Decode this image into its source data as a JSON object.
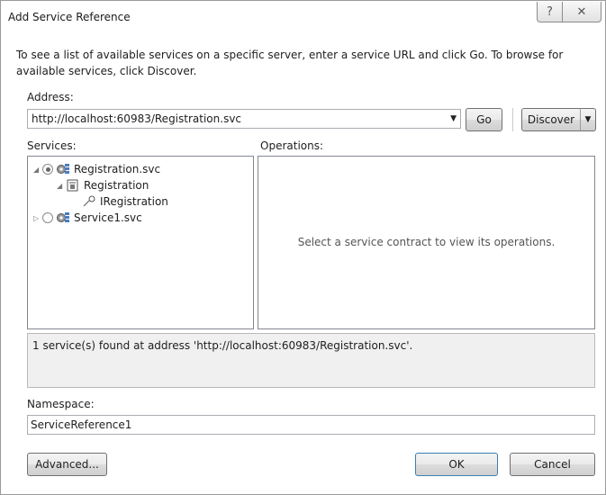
{
  "window": {
    "title": "Add Service Reference",
    "help_icon": "?",
    "close_icon": "✕"
  },
  "instructions": "To see a list of available services on a specific server, enter a service URL and click Go. To browse for available services, click Discover.",
  "address": {
    "label": "Address:",
    "value": "http://localhost:60983/Registration.svc",
    "go_label": "Go",
    "discover_label": "Discover"
  },
  "services": {
    "label": "Services:",
    "tree": [
      {
        "label": "Registration.svc",
        "expanded": true,
        "selected_radio": true,
        "icon": "service-gear-icon"
      },
      {
        "label": "Registration",
        "expanded": true,
        "icon": "class-icon"
      },
      {
        "label": "IRegistration",
        "icon": "interface-icon"
      },
      {
        "label": "Service1.svc",
        "expanded": false,
        "selected_radio": false,
        "icon": "service-gear-icon"
      }
    ]
  },
  "operations": {
    "label": "Operations:",
    "placeholder": "Select a service contract to view its operations."
  },
  "status_text": "1 service(s) found at address 'http://localhost:60983/Registration.svc'.",
  "namespace": {
    "label": "Namespace:",
    "value": "ServiceReference1"
  },
  "buttons": {
    "advanced": "Advanced...",
    "ok": "OK",
    "cancel": "Cancel"
  }
}
